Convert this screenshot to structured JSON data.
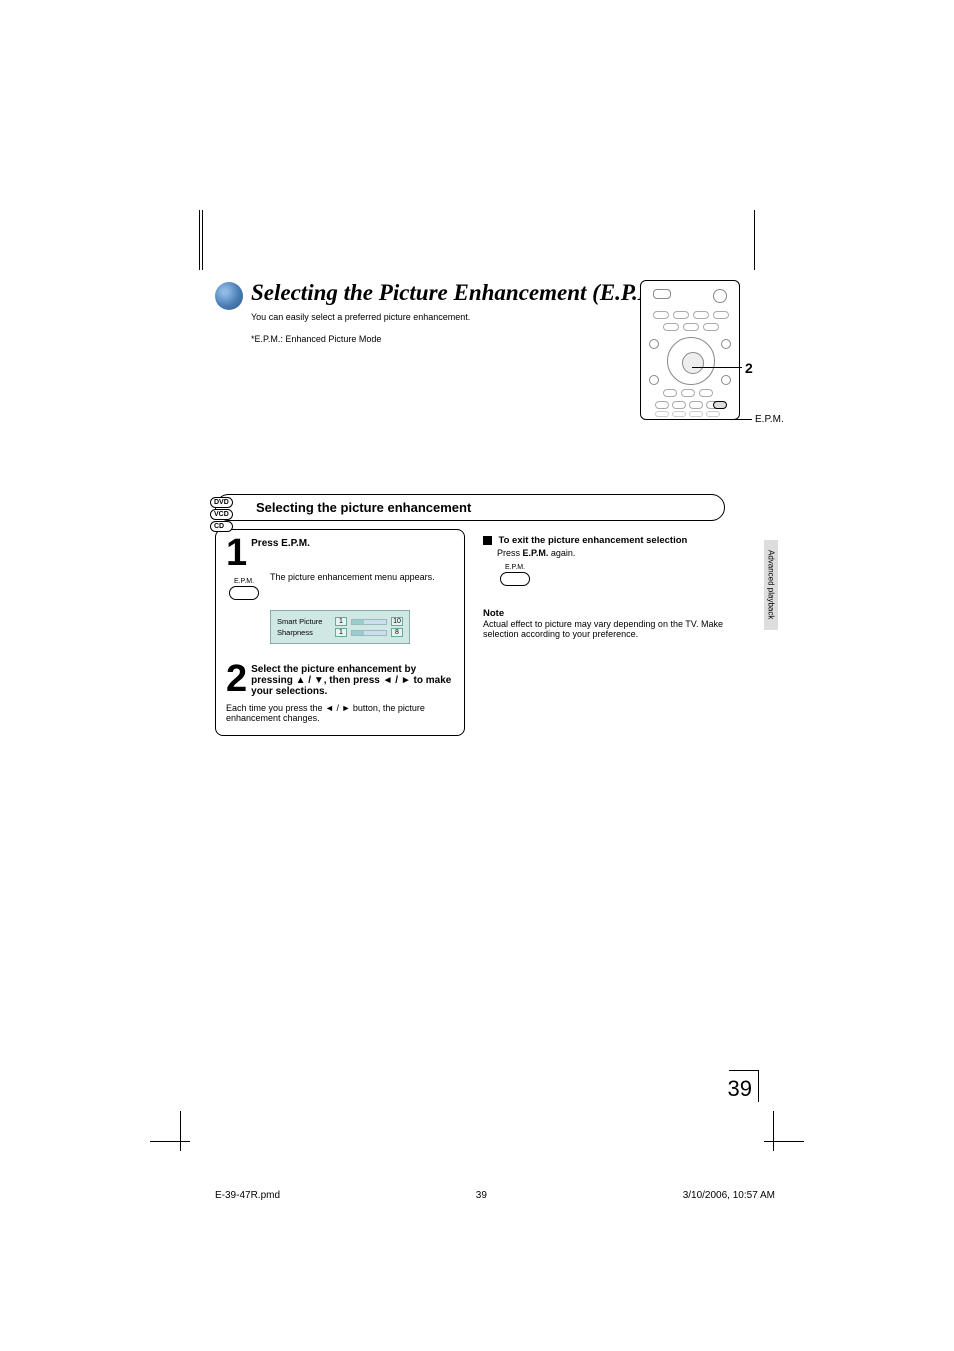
{
  "title": "Selecting the Picture Enhancement (E.P.M.*)",
  "subtitle": "You can easily select a preferred picture enhancement.",
  "epm_footnote": "*E.P.M.: Enhanced Picture Mode",
  "callout": {
    "num": "2",
    "label": "E.P.M."
  },
  "disc_labels": [
    "DVD",
    "VCD",
    "CD"
  ],
  "section_heading": "Selecting the picture enhancement",
  "step1": {
    "num": "1",
    "heading": "Press E.P.M.",
    "button_label": "E.P.M.",
    "body": "The picture enhancement menu appears.",
    "menu": {
      "rows": [
        {
          "label": "Smart Picture",
          "left": "1",
          "right": "10"
        },
        {
          "label": "Sharpness",
          "left": "1",
          "right": "8"
        }
      ]
    }
  },
  "step2": {
    "num": "2",
    "heading": "Select the picture enhancement by pressing ▲ / ▼, then press ◄ / ► to make your selections.",
    "body": "Each time you press the ◄ / ► button, the picture enhancement changes."
  },
  "exit": {
    "heading": "To exit the picture enhancement selection",
    "body": "Press E.P.M. again.",
    "button_label": "E.P.M."
  },
  "note": {
    "heading": "Note",
    "body": "Actual effect to picture may vary depending on the TV. Make selection according to your preference."
  },
  "side_tab": "Advanced playback",
  "page_number": "39",
  "footer": {
    "file": "E-39-47R.pmd",
    "page": "39",
    "timestamp": "3/10/2006, 10:57 AM"
  }
}
